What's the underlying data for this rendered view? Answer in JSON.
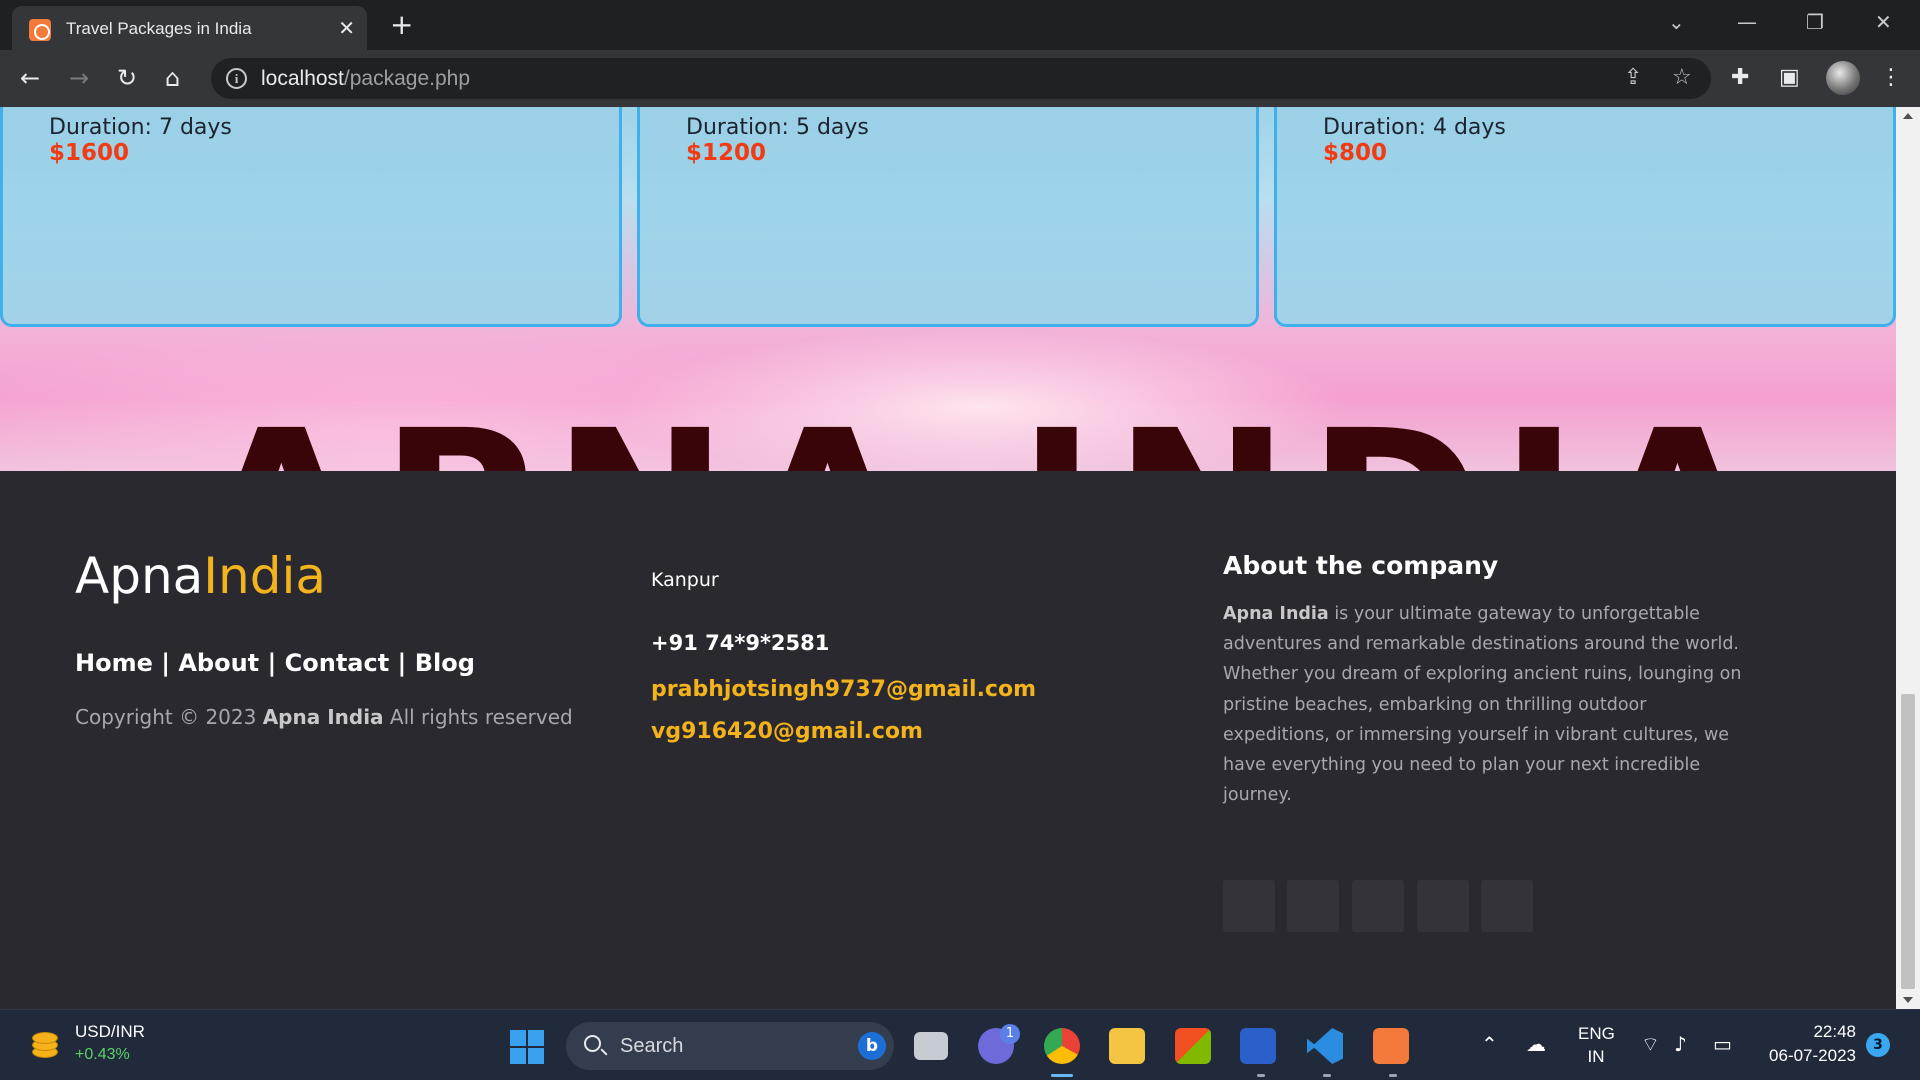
{
  "browser": {
    "tab_title": "Travel Packages in India",
    "tab_close": "✕",
    "new_tab": "+",
    "url_host": "localhost",
    "url_path": "/package.php",
    "window_controls": [
      "⌄",
      "—",
      "❐",
      "✕"
    ]
  },
  "packages": [
    {
      "duration": "Duration: 7 days",
      "price": "$1600"
    },
    {
      "duration": "Duration: 5 days",
      "price": "$1200"
    },
    {
      "duration": "Duration: 4 days",
      "price": "$800"
    }
  ],
  "hero": {
    "text": "APNA INDIA"
  },
  "footer": {
    "logo_part1": "Apna",
    "logo_part2": "India",
    "links": [
      "Home",
      "About",
      "Contact",
      "Blog"
    ],
    "link_separator": " | ",
    "copyright_prefix": "Copyright © 2023 ",
    "copyright_brand": "Apna India",
    "copyright_suffix": " All rights reserved",
    "city": "Kanpur",
    "phone": "+91 74*9*2581",
    "emails": [
      "prabhjotsingh9737@gmail.com",
      "vg916420@gmail.com"
    ],
    "about_title": "About the company",
    "about_brand": "Apna India",
    "about_text": " is your ultimate gateway to unforgettable adventures and remarkable destinations around the world. Whether you dream of exploring ancient ruins, lounging on pristine beaches, embarking on thrilling outdoor expeditions, or immersing yourself in vibrant cultures, we have everything you need to plan your next incredible journey.",
    "social_icons": [
      "social-icon-1",
      "social-icon-2",
      "social-icon-3",
      "social-icon-4",
      "social-icon-5"
    ]
  },
  "taskbar": {
    "ticker_name": "USD/INR",
    "ticker_change": "+0.43%",
    "search_label": "Search",
    "chat_badge": "1",
    "language_line1": "ENG",
    "language_line2": "IN",
    "time": "22:48",
    "date": "06-07-2023",
    "notification_count": "3"
  },
  "colors": {
    "accent_yellow": "#f2b31c",
    "price_red": "#f23b12",
    "card_border": "#3fb0ec",
    "footer_bg": "#2a2930"
  }
}
